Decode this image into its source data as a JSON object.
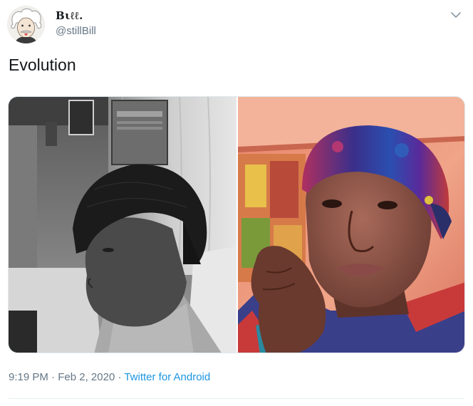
{
  "tweet": {
    "author": {
      "display_name": "Bιℓℓ.",
      "handle": "@stillBill",
      "avatar_icon": "cartoon-portrait-avatar"
    },
    "text": "Evolution",
    "media": {
      "left_photo": "grayscale-portrait-photo",
      "right_photo": "color-selfie-photo"
    },
    "meta": {
      "time": "9:19 PM",
      "separator": " · ",
      "date": "Feb 2, 2020",
      "source": "Twitter for Android"
    },
    "menu_icon": "chevron-down-icon"
  },
  "colors": {
    "text_primary": "#14171a",
    "text_secondary": "#657786",
    "link": "#1b95e0",
    "divider": "#e6ecf0"
  }
}
